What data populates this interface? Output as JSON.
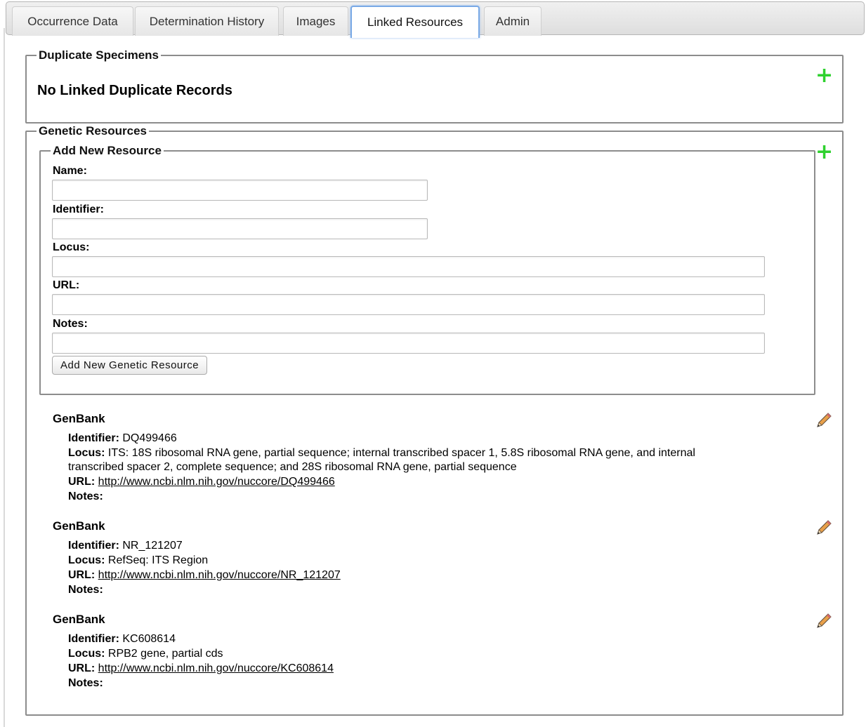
{
  "tabs": [
    {
      "label": "Occurrence Data"
    },
    {
      "label": "Determination History"
    },
    {
      "label": "Images"
    },
    {
      "label": "Linked Resources"
    },
    {
      "label": "Admin"
    }
  ],
  "duplicates": {
    "legend": "Duplicate Specimens",
    "message": "No Linked Duplicate Records",
    "add_icon": "plus-icon"
  },
  "genetic": {
    "legend": "Genetic Resources",
    "add_icon": "plus-icon",
    "form": {
      "legend": "Add New Resource",
      "name_label": "Name:",
      "identifier_label": "Identifier:",
      "locus_label": "Locus:",
      "url_label": "URL:",
      "notes_label": "Notes:",
      "name_value": "",
      "identifier_value": "",
      "locus_value": "",
      "url_value": "",
      "notes_value": "",
      "submit_label": "Add New Genetic Resource"
    },
    "field_labels": {
      "identifier": "Identifier:",
      "locus": "Locus:",
      "url": "URL:",
      "notes": "Notes:"
    },
    "records": [
      {
        "title": "GenBank",
        "identifier": "DQ499466",
        "locus_line1": "ITS: 18S ribosomal RNA gene, partial sequence; internal transcribed spacer 1, 5.8S ribosomal RNA gene, and internal",
        "locus_line2": "transcribed spacer 2, complete sequence; and 28S ribosomal RNA gene, partial sequence",
        "url": "http://www.ncbi.nlm.nih.gov/nuccore/DQ499466",
        "notes": ""
      },
      {
        "title": "GenBank",
        "identifier": "NR_121207",
        "locus_line1": "RefSeq: ITS Region",
        "url": "http://www.ncbi.nlm.nih.gov/nuccore/NR_121207",
        "notes": ""
      },
      {
        "title": "GenBank",
        "identifier": "KC608614",
        "locus_line1": "RPB2 gene, partial cds",
        "url": "http://www.ncbi.nlm.nih.gov/nuccore/KC608614",
        "notes": ""
      }
    ],
    "edit_icon": "pencil-icon"
  },
  "colors": {
    "add_icon": "#2ed12e",
    "active_tab_border": "#79a9e6",
    "fieldset_border": "#8c8c8c"
  }
}
